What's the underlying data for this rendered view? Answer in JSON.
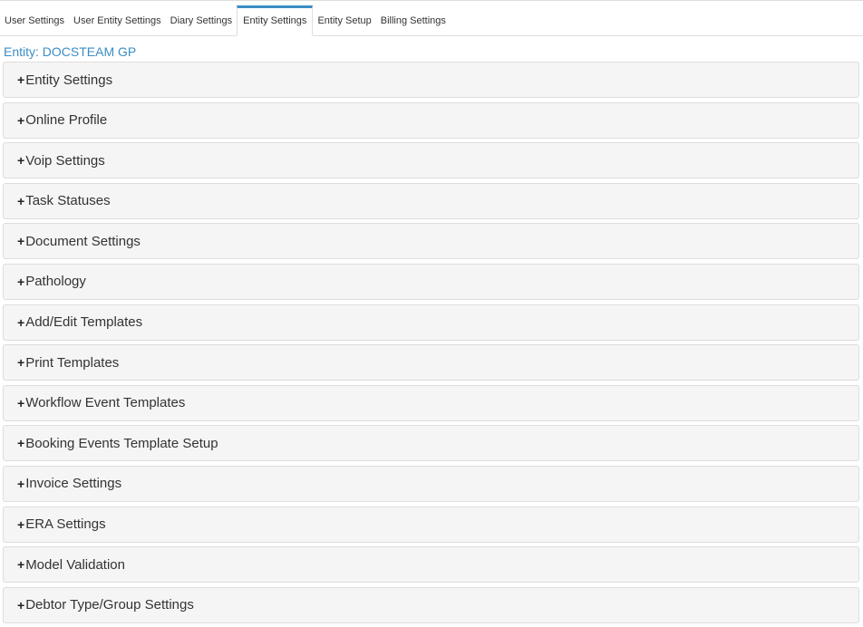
{
  "tabs": [
    {
      "label": "User Settings",
      "active": false
    },
    {
      "label": "User Entity Settings",
      "active": false
    },
    {
      "label": "Diary Settings",
      "active": false
    },
    {
      "label": "Entity Settings",
      "active": true
    },
    {
      "label": "Entity Setup",
      "active": false
    },
    {
      "label": "Billing Settings",
      "active": false
    }
  ],
  "entity_label": "Entity: DOCSTEAM GP",
  "expand_symbol": "+",
  "panels": [
    "Entity Settings",
    "Online Profile",
    "Voip Settings",
    "Task Statuses",
    "Document Settings",
    "Pathology",
    "Add/Edit Templates",
    "Print Templates",
    "Workflow Event Templates",
    "Booking Events Template Setup",
    "Invoice Settings",
    "ERA Settings",
    "Model Validation",
    "Debtor Type/Group Settings"
  ],
  "colors": {
    "accent": "#3b8dc4",
    "panel_bg": "#f5f5f5"
  }
}
